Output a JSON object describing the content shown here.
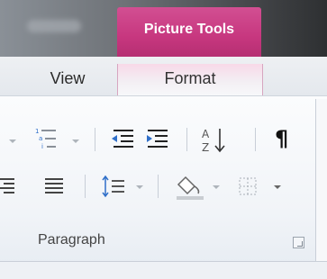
{
  "context_tab": {
    "label": "Picture Tools"
  },
  "tabs": [
    {
      "label": "View"
    },
    {
      "label": "Format"
    }
  ],
  "paragraph_group": {
    "label": "Paragraph",
    "pilcrow": "¶"
  },
  "colors": {
    "context_accent": "#c7377f",
    "ribbon_bg": "#f1f4f8",
    "icon_blue": "#2f6fc9"
  }
}
